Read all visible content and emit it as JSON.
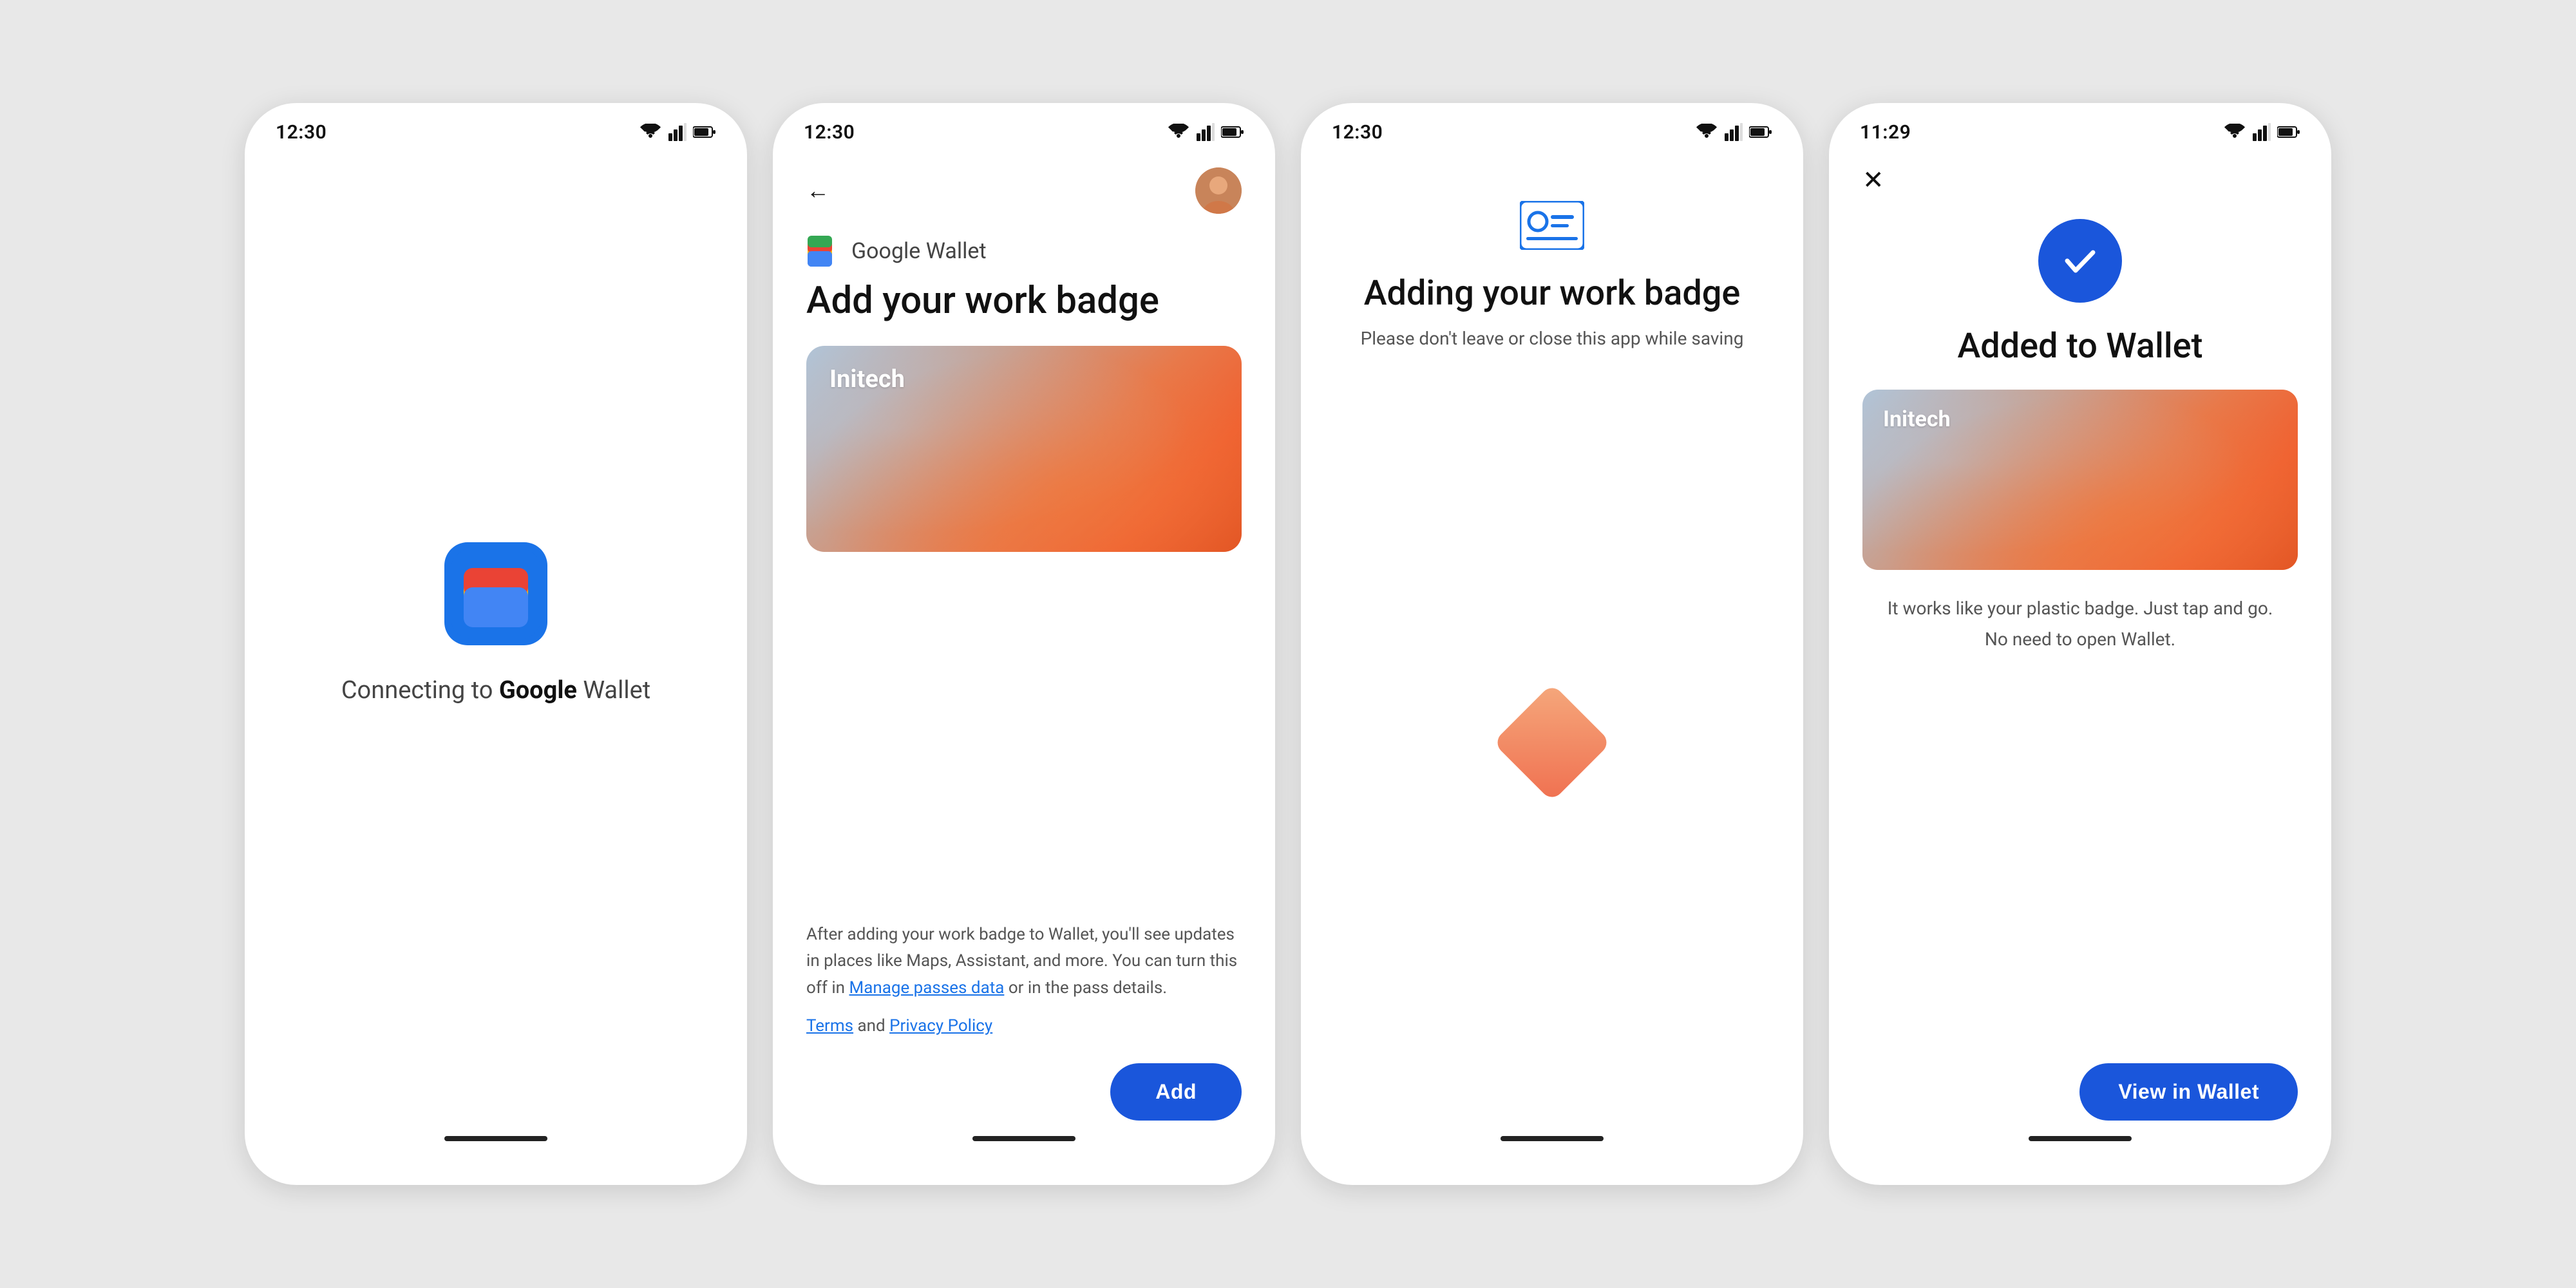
{
  "screen1": {
    "time": "12:30",
    "connecting_text_prefix": "Connecting to ",
    "connecting_text_brand": "Google",
    "connecting_text_suffix": " Wallet"
  },
  "screen2": {
    "time": "12:30",
    "back_icon": "←",
    "brand_name": "Google Wallet",
    "title": "Add your work badge",
    "badge_label": "Initech",
    "info_text": "After adding your work badge to Wallet, you'll see updates in places like Maps, Assistant, and more. You can turn this off in ",
    "info_link": "Manage passes data",
    "info_text2": " or in the pass details.",
    "terms_prefix": "",
    "terms_link1": "Terms",
    "terms_and": " and ",
    "terms_link2": "Privacy Policy",
    "add_button": "Add"
  },
  "screen3": {
    "time": "12:30",
    "title": "Adding your work badge",
    "subtitle": "Please don't leave or close this app while saving"
  },
  "screen4": {
    "time": "11:29",
    "close_icon": "✕",
    "title": "Added to Wallet",
    "badge_label": "Initech",
    "description": "It works like your plastic badge. Just tap and go. No need to open Wallet.",
    "view_button": "View in Wallet"
  },
  "icons": {
    "wifi": "wifi",
    "signal": "signal",
    "battery": "battery",
    "checkmark": "✓",
    "badge_id": "badge"
  }
}
